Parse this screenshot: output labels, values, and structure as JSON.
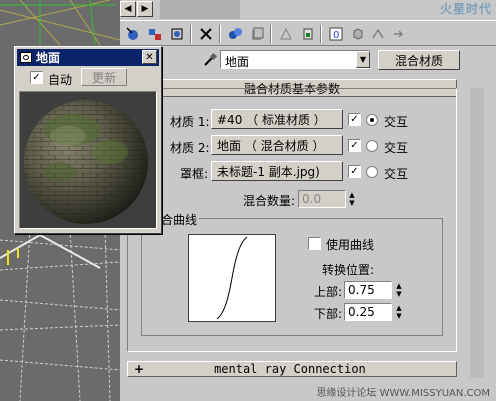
{
  "watermark_top": "火星时代",
  "watermark_bottom": "思缘设计论坛 WWW.MISSYUAN.COM",
  "material_name": "地面",
  "material_type_button": "混合材质",
  "rollout_title": "融合材质基本参数",
  "materials": [
    {
      "label": "材质 1:",
      "value": "#40  （ 标准材质 ）",
      "interactive_label": "交互",
      "interactive_on": true
    },
    {
      "label": "材质 2:",
      "value": "地面  （ 混合材质 ）",
      "interactive_label": "交互",
      "interactive_on": false
    },
    {
      "label": "罩框:",
      "value": "未标题-1 副本.jpg)",
      "interactive_label": "交互",
      "interactive_on": false
    }
  ],
  "mix_amount": {
    "label": "混合数量:",
    "value": "0.0"
  },
  "curve": {
    "group_title": "合曲线",
    "use_curve_label": "使用曲线",
    "transition_label": "转换位置:",
    "upper_label": "上部:",
    "upper_value": "0.75",
    "lower_label": "下部:",
    "lower_value": "0.25"
  },
  "mental_ray_rollout": {
    "sign": "+",
    "title": "mental ray Connection"
  },
  "preview_window": {
    "title": "地面",
    "auto_label": "自动",
    "update_button": "更新",
    "close_glyph": "✕"
  }
}
